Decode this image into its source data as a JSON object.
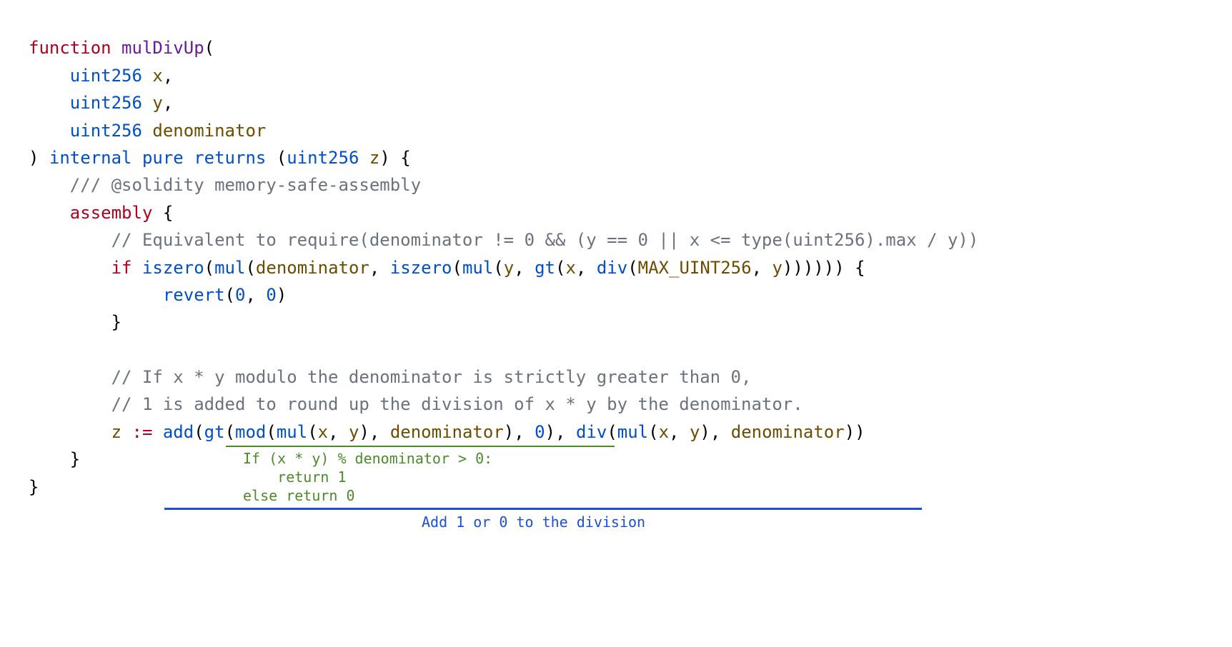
{
  "code": {
    "l1": {
      "kw": "function",
      "name": "mulDivUp",
      "p": "("
    },
    "l2": {
      "type": "uint256",
      "id": "x",
      "c": ","
    },
    "l3": {
      "type": "uint256",
      "id": "y",
      "c": ","
    },
    "l4": {
      "type": "uint256",
      "id": "denominator"
    },
    "l5": {
      "p1": ")",
      "mod": "internal pure returns",
      "p2": "(",
      "type": "uint256",
      "id": "z",
      "p3": ") {"
    },
    "l6": {
      "comment": "/// @solidity memory-safe-assembly"
    },
    "l7": {
      "kw": "assembly",
      "p": " {"
    },
    "l8": {
      "comment": "// Equivalent to require(denominator != 0 && (y == 0 || x <= type(uint256).max / y))"
    },
    "l9": {
      "kw": "if",
      "c1": "iszero",
      "p1": "(",
      "c2": "mul",
      "p2": "(",
      "id1": "denominator",
      "p3": ", ",
      "c3": "iszero",
      "p4": "(",
      "c4": "mul",
      "p5": "(",
      "id2": "y",
      "p6": ", ",
      "c5": "gt",
      "p7": "(",
      "id3": "x",
      "p8": ", ",
      "c6": "div",
      "p9": "(",
      "id4": "MAX_UINT256",
      "p10": ", ",
      "id5": "y",
      "p11": "))))))",
      "p12": " {"
    },
    "l10": {
      "c": "revert",
      "p1": "(",
      "n1": "0",
      "p2": ", ",
      "n2": "0",
      "p3": ")"
    },
    "l11": {
      "p": "}"
    },
    "l13": {
      "comment": "// If x * y modulo the denominator is strictly greater than 0,"
    },
    "l14": {
      "comment": "// 1 is added to round up the division of x * y by the denominator."
    },
    "l15": {
      "id": "z",
      "op": ":=",
      "c1": "add",
      "p1": "(",
      "c2": "gt",
      "p2": "(",
      "c3": "mod",
      "p3": "(",
      "c4": "mul",
      "p4": "(",
      "id1": "x",
      "p5": ", ",
      "id2": "y",
      "p6": "), ",
      "id3": "denominator",
      "p7": "), ",
      "n1": "0",
      "p8": "), ",
      "c5": "div",
      "p9": "(",
      "c6": "mul",
      "p10": "(",
      "id4": "x",
      "p11": ", ",
      "id5": "y",
      "p12": "), ",
      "id6": "denominator",
      "p13": "))"
    },
    "l16": {
      "p": "}"
    },
    "l17": {
      "p": "}"
    }
  },
  "annotations": {
    "green_text": "If (x * y) % denominator > 0:\n    return 1\nelse return 0",
    "blue_text": "Add 1 or 0 to the division"
  }
}
